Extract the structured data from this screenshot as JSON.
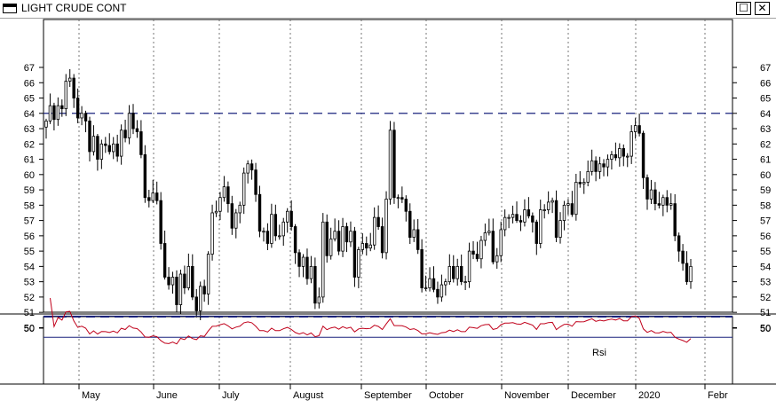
{
  "window": {
    "title": "LIGHT CRUDE CONT",
    "maximize_glyph": "☐",
    "close_glyph": "✕"
  },
  "chart_data": [
    {
      "type": "candlestick",
      "title": "LIGHT CRUDE CONT",
      "x_labels": [
        "May",
        "June",
        "July",
        "August",
        "September",
        "October",
        "November",
        "December",
        "2020",
        "Febr"
      ],
      "ylim": [
        49.5,
        68
      ],
      "y_ticks": [
        50,
        51,
        52,
        53,
        54,
        55,
        56,
        57,
        58,
        59,
        60,
        61,
        62,
        63,
        64,
        65,
        66,
        67
      ],
      "reference_lines": [
        64,
        50.7
      ],
      "closes": [
        63.5,
        64.5,
        63.6,
        64.5,
        64.3,
        66.1,
        66.3,
        65.0,
        63.7,
        64.0,
        63.5,
        61.5,
        62.5,
        61.0,
        62.0,
        61.9,
        61.5,
        62.0,
        61.2,
        62.9,
        62.4,
        64.0,
        63.0,
        62.8,
        61.3,
        58.5,
        58.3,
        58.8,
        58.3,
        55.5,
        53.3,
        52.8,
        53.3,
        51.5,
        53.5,
        52.6,
        54.0,
        52.0,
        51.1,
        52.7,
        52.2,
        54.8,
        57.5,
        57.6,
        58.5,
        59.2,
        58.1,
        56.5,
        57.5,
        58.0,
        60.1,
        60.7,
        60.3,
        58.7,
        56.3,
        56.3,
        55.5,
        57.4,
        56.0,
        56.0,
        56.9,
        57.6,
        56.6,
        54.9,
        54.0,
        54.6,
        53.2,
        54.0,
        51.6,
        52.0,
        56.9,
        54.7,
        55.8,
        56.3,
        55.0,
        56.6,
        55.6,
        56.3,
        53.3,
        55.1,
        55.5,
        55.2,
        55.4,
        57.2,
        56.6,
        54.9,
        58.4,
        62.9,
        58.5,
        58.5,
        58.4,
        57.6,
        55.9,
        56.4,
        55.1,
        52.6,
        52.6,
        53.2,
        52.5,
        52.0,
        52.8,
        53.0,
        54.0,
        53.2,
        54.0,
        53.0,
        53.0,
        55.0,
        54.8,
        54.5,
        55.7,
        56.2,
        56.3,
        54.3,
        54.7,
        56.4,
        57.2,
        57.2,
        57.4,
        57.0,
        56.9,
        57.7,
        57.3,
        56.9,
        55.5,
        57.7,
        57.7,
        58.2,
        58.3,
        55.9,
        57.0,
        58.0,
        58.1,
        57.4,
        59.5,
        59.4,
        59.5,
        60.2,
        60.9,
        60.2,
        60.7,
        60.5,
        61.0,
        61.3,
        61.1,
        61.7,
        61.2,
        61.2,
        62.8,
        63.2,
        62.7,
        59.8,
        58.4,
        59.0,
        58.1,
        58.0,
        58.5,
        58.0,
        58.1,
        56.0,
        55.0,
        54.2,
        53.0,
        54.0
      ],
      "series": [
        {
          "name": "Rsi",
          "type": "line",
          "y_ticks": [
            50
          ],
          "reference_lines": [
            70,
            35
          ]
        }
      ]
    }
  ]
}
